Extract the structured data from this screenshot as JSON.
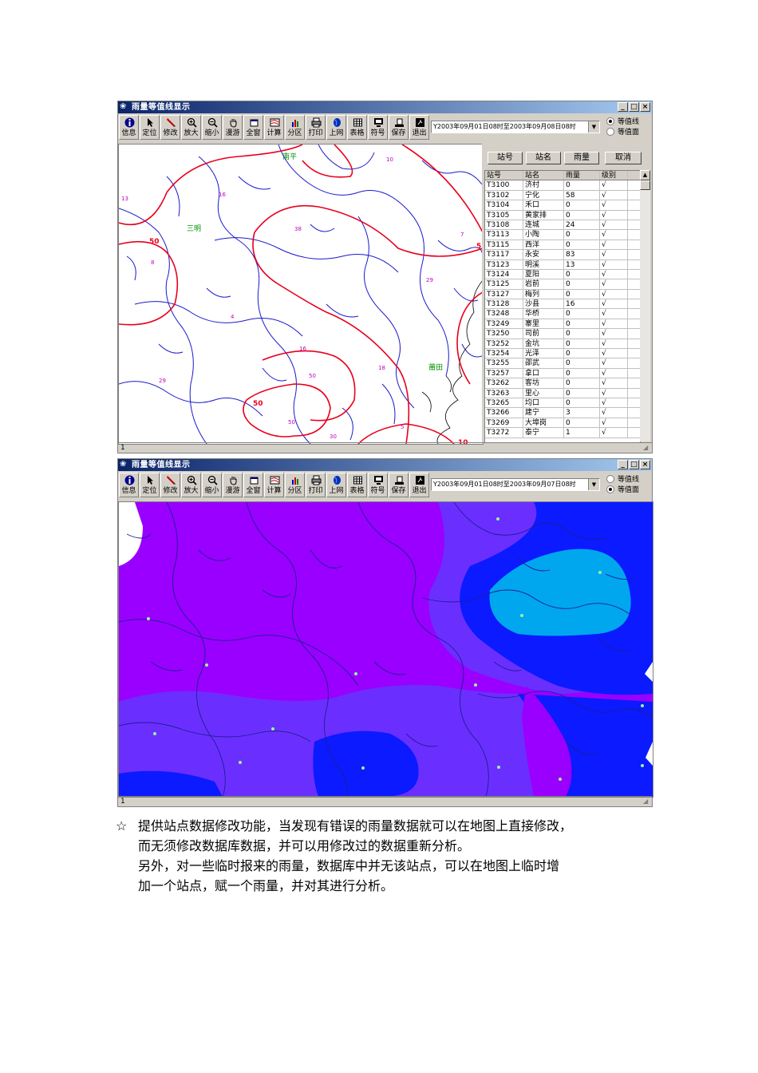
{
  "window1": {
    "title": "雨量等值线显示",
    "controls": [
      "_",
      "□",
      "×"
    ],
    "toolbar": [
      "信息",
      "定位",
      "修改",
      "放大",
      "缩小",
      "漫游",
      "全窗",
      "计算",
      "分区",
      "打印",
      "上网",
      "表格",
      "符号",
      "保存",
      "退出"
    ],
    "time_range": "Y2003年09月01日08时至2003年09月08日08时",
    "display_modes": [
      "等值线",
      "等值面"
    ],
    "selected_mode": "等值线",
    "panel_buttons": [
      "站号",
      "站名",
      "雨量",
      "取消"
    ],
    "table_headers": [
      "站号",
      "站名",
      "雨量",
      "级别"
    ],
    "stations": [
      [
        "T3100",
        "济村",
        "0",
        "√"
      ],
      [
        "T3102",
        "宁化",
        "58",
        "√"
      ],
      [
        "T3104",
        "禾口",
        "0",
        "√"
      ],
      [
        "T3105",
        "黄家排",
        "0",
        "√"
      ],
      [
        "T3108",
        "连城",
        "24",
        "√"
      ],
      [
        "T3113",
        "小陶",
        "0",
        "√"
      ],
      [
        "T3115",
        "西洋",
        "0",
        "√"
      ],
      [
        "T3117",
        "永安",
        "83",
        "√"
      ],
      [
        "T3123",
        "明溪",
        "13",
        "√"
      ],
      [
        "T3124",
        "夏阳",
        "0",
        "√"
      ],
      [
        "T3125",
        "岩前",
        "0",
        "√"
      ],
      [
        "T3127",
        "梅列",
        "0",
        "√"
      ],
      [
        "T3128",
        "沙县",
        "16",
        "√"
      ],
      [
        "T3248",
        "华桥",
        "0",
        "√"
      ],
      [
        "T3249",
        "寨里",
        "0",
        "√"
      ],
      [
        "T3250",
        "司前",
        "0",
        "√"
      ],
      [
        "T3252",
        "金坑",
        "0",
        "√"
      ],
      [
        "T3254",
        "光泽",
        "0",
        "√"
      ],
      [
        "T3255",
        "邵武",
        "0",
        "√"
      ],
      [
        "T3257",
        "拿口",
        "0",
        "√"
      ],
      [
        "T3262",
        "客坊",
        "0",
        "√"
      ],
      [
        "T3263",
        "里心",
        "0",
        "√"
      ],
      [
        "T3265",
        "均口",
        "0",
        "√"
      ],
      [
        "T3266",
        "建宁",
        "3",
        "√"
      ],
      [
        "T3269",
        "大埠岗",
        "0",
        "√"
      ],
      [
        "T3272",
        "泰宁",
        "1",
        "√"
      ]
    ],
    "map_labels": [
      "南平",
      "三明",
      "莆田"
    ],
    "contour_labels": [
      "50",
      "50",
      "5",
      "10"
    ],
    "station_values": [
      "10",
      "13",
      "16",
      "8",
      "38",
      "7",
      "29",
      "4",
      "16",
      "50",
      "18",
      "29",
      "50",
      "30",
      "5"
    ],
    "status": "1"
  },
  "window2": {
    "title": "雨量等值线显示",
    "controls": [
      "_",
      "□",
      "×"
    ],
    "toolbar": [
      "信息",
      "定位",
      "修改",
      "放大",
      "缩小",
      "漫游",
      "全窗",
      "计算",
      "分区",
      "打印",
      "上网",
      "表格",
      "符号",
      "保存",
      "退出"
    ],
    "time_range": "Y2003年09月01日08时至2003年09月07日08时",
    "display_modes": [
      "等值线",
      "等值面"
    ],
    "selected_mode": "等值面",
    "fill_colors": {
      "low": "#9900ff",
      "mid": "#6a2fff",
      "high": "#0b1aff",
      "top": "#00a6ee"
    },
    "status": "1"
  },
  "notes": {
    "bullet": "☆",
    "lines": [
      "提供站点数据修改功能，当发现有错误的雨量数据就可以在地图上直接修改，",
      "而无须修改数据库数据，并可以用修改过的数据重新分析。",
      "另外，对一些临时报来的雨量，数据库中并无该站点，可以在地图上临时增",
      "加一个站点，赋一个雨量，并对其进行分析。"
    ]
  }
}
